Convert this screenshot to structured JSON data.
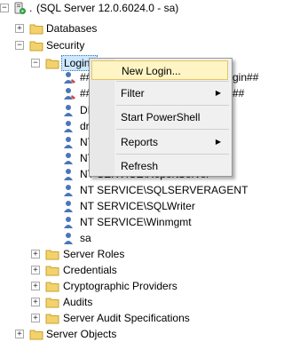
{
  "tree": {
    "server": "(SQL Server 12.0.6024.0 - sa)",
    "server_prefix": ".",
    "databases": "Databases",
    "security": "Security",
    "logins": "Logins",
    "login_items": [
      {
        "label": "##",
        "tail": "gin##"
      },
      {
        "label": "##",
        "tail": "##"
      },
      {
        "label": "DI",
        "tail": ""
      },
      {
        "label": "dr",
        "tail": ""
      },
      {
        "label": "NT",
        "tail": ""
      },
      {
        "label": "NT",
        "tail": ""
      },
      {
        "label": "NT SERVICE\\ReportServer",
        "tail": ""
      },
      {
        "label": "NT SERVICE\\SQLSERVERAGENT",
        "tail": ""
      },
      {
        "label": "NT SERVICE\\SQLWriter",
        "tail": ""
      },
      {
        "label": "NT SERVICE\\Winmgmt",
        "tail": ""
      },
      {
        "label": "sa",
        "tail": ""
      }
    ],
    "security_children": [
      "Server Roles",
      "Credentials",
      "Cryptographic Providers",
      "Audits",
      "Server Audit Specifications"
    ],
    "server_objects": "Server Objects"
  },
  "context_menu": {
    "new_login": "New Login...",
    "filter": "Filter",
    "start_powershell": "Start PowerShell",
    "reports": "Reports",
    "refresh": "Refresh"
  },
  "icons": {
    "toggle_expanded": "−",
    "toggle_collapsed": "+",
    "submenu_arrow": "▶"
  }
}
